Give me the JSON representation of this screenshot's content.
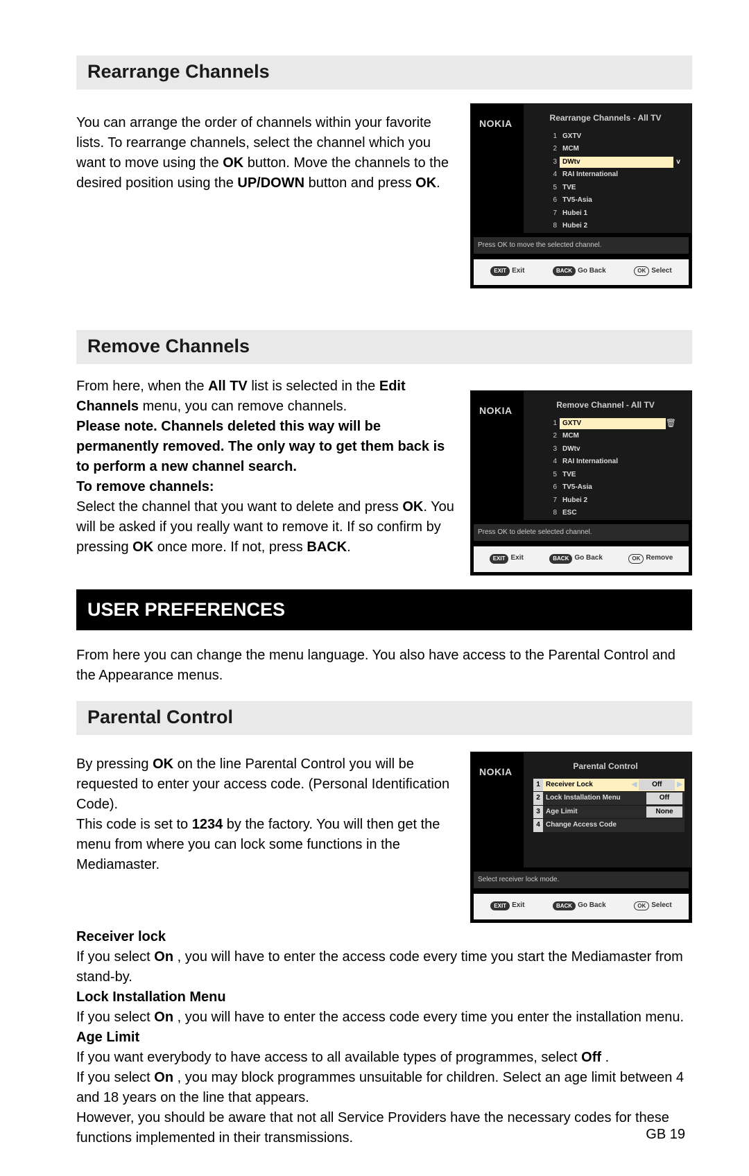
{
  "brand": "NOKIA",
  "page_number": "GB 19",
  "rearrange": {
    "heading": "Rearrange Channels",
    "p_start": "You can arrange the order of channels within your favorite lists. To rearrange channels, select the channel which you want to move using the ",
    "b1": "OK",
    "p_mid": " button. Move the channels to the desired position using the ",
    "b2": "UP/DOWN",
    "p_mid2": " button and press ",
    "b3": "OK",
    "p_end": ".",
    "screen": {
      "title": "Rearrange Channels - All TV",
      "items": [
        {
          "n": "1",
          "name": "GXTV",
          "sel": false,
          "flag": ""
        },
        {
          "n": "2",
          "name": "MCM",
          "sel": false,
          "flag": ""
        },
        {
          "n": "3",
          "name": "DWtv",
          "sel": true,
          "flag": "v"
        },
        {
          "n": "4",
          "name": "RAI International",
          "sel": false,
          "flag": ""
        },
        {
          "n": "5",
          "name": "TVE",
          "sel": false,
          "flag": ""
        },
        {
          "n": "6",
          "name": "TV5-Asia",
          "sel": false,
          "flag": ""
        },
        {
          "n": "7",
          "name": "Hubei 1",
          "sel": false,
          "flag": ""
        },
        {
          "n": "8",
          "name": "Hubei 2",
          "sel": false,
          "flag": ""
        }
      ],
      "hint": "Press OK to move the selected channel.",
      "exit": "Exit",
      "back": "Go Back",
      "ok": "Select",
      "exit_btn": "EXIT",
      "back_btn": "BACK",
      "ok_btn": "OK"
    }
  },
  "remove": {
    "heading": "Remove Channels",
    "p1a": "From here, when the  ",
    "p1b": "All TV",
    "p1c": "  list   is selected in the  ",
    "p1d": "Edit Channels",
    "p1e": "   menu, you can remove channels.",
    "p2": "Please note. Channels deleted this way will be permanently removed. The only way to get them back is to perform a new channel search.",
    "p3h": "To remove channels:",
    "p4a": "Select the channel that you want to delete and press ",
    "p4b": "OK",
    "p4c": ". You will be asked if you really want to remove it. If so confirm by pressing ",
    "p4d": "OK",
    "p4e": " once more. If not, press ",
    "p4f": "BACK",
    "p4g": ".",
    "screen": {
      "title": "Remove Channel - All TV",
      "items": [
        {
          "n": "1",
          "name": "GXTV",
          "sel": true,
          "flag": "trash"
        },
        {
          "n": "2",
          "name": "MCM",
          "sel": false,
          "flag": ""
        },
        {
          "n": "3",
          "name": "DWtv",
          "sel": false,
          "flag": ""
        },
        {
          "n": "4",
          "name": "RAI International",
          "sel": false,
          "flag": ""
        },
        {
          "n": "5",
          "name": "TVE",
          "sel": false,
          "flag": ""
        },
        {
          "n": "6",
          "name": "TV5-Asia",
          "sel": false,
          "flag": ""
        },
        {
          "n": "7",
          "name": "Hubei 2",
          "sel": false,
          "flag": ""
        },
        {
          "n": "8",
          "name": "ESC",
          "sel": false,
          "flag": ""
        }
      ],
      "hint": "Press OK to delete selected channel.",
      "exit": "Exit",
      "back": "Go Back",
      "ok": "Remove",
      "exit_btn": "EXIT",
      "back_btn": "BACK",
      "ok_btn": "OK"
    }
  },
  "user_prefs": {
    "heading": "USER PREFERENCES",
    "p": "From here you can change the menu language. You also have access to the Parental Control and the Appearance menus."
  },
  "parental": {
    "heading": "Parental Control",
    "p1a": "By pressing ",
    "p1b": "OK",
    "p1c": " on the line  Parental Control  you will be requested to enter your access code. (Personal Identification Code).",
    "p2a": "This code is set to ",
    "p2b": "1234",
    "p2c": " by the factory. You will then get the menu from where you can lock some functions in the Mediamaster.",
    "screen": {
      "title": "Parental Control",
      "opts": [
        {
          "n": "1",
          "name": "Receiver Lock",
          "val": "Off",
          "sel": true
        },
        {
          "n": "2",
          "name": "Lock Installation Menu",
          "val": "Off",
          "sel": false
        },
        {
          "n": "3",
          "name": "Age Limit",
          "val": "None",
          "sel": false
        },
        {
          "n": "4",
          "name": "Change Access Code",
          "val": "",
          "sel": false
        }
      ],
      "hint": "Select receiver lock mode.",
      "exit": "Exit",
      "back": "Go Back",
      "ok": "Select",
      "exit_btn": "EXIT",
      "back_btn": "BACK",
      "ok_btn": "OK"
    },
    "rl_h": "Receiver lock",
    "rl_a": "If you select  ",
    "rl_b": "On",
    "rl_c": " , you will have to enter the access code every time you start the  Mediamaster from stand-by.",
    "lim_h": "Lock Installation Menu",
    "lim_a": "If you select  ",
    "lim_b": "On",
    "lim_c": " , you will have to enter the access code every time you enter the installation menu.",
    "age_h": "Age Limit",
    "age_a": "If you want everybody to have access to all available types of programmes, select  ",
    "age_b": "Off",
    "age_c": " .",
    "age_d": "If you select  ",
    "age_e": "On",
    "age_f": " , you may block programmes unsuitable for children. Select an age limit between 4 and 18 years on the line that appears.",
    "age_g": "However, you should be aware that not all Service Providers have the necessary codes for these functions implemented in their transmissions."
  }
}
